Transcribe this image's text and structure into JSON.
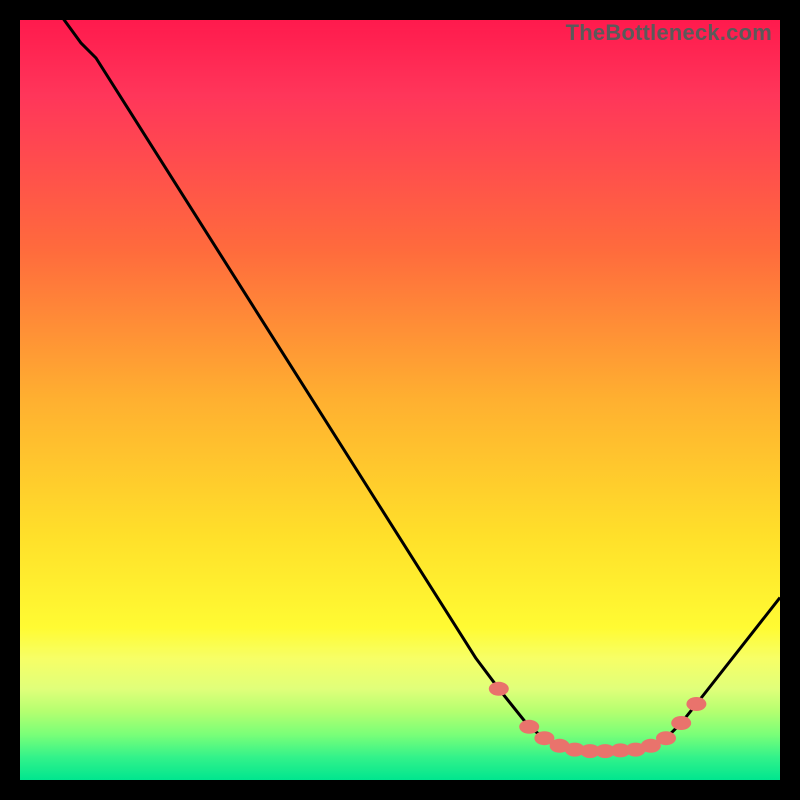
{
  "watermark": "TheBottleneck.com",
  "colors": {
    "marker": "#e9736c",
    "line": "#000000",
    "frame": "#000000"
  },
  "chart_data": {
    "type": "line",
    "title": "",
    "xlabel": "",
    "ylabel": "",
    "xlim": [
      0,
      100
    ],
    "ylim": [
      0,
      100
    ],
    "grid": false,
    "series": [
      {
        "name": "curve",
        "x": [
          0,
          8,
          10,
          60,
          63,
          67,
          69,
          71,
          73,
          75,
          77,
          79,
          81,
          83,
          85,
          87,
          89,
          100
        ],
        "y": [
          108,
          97,
          95,
          16,
          12,
          7,
          5.5,
          4.5,
          4.0,
          3.8,
          3.8,
          3.9,
          4.0,
          4.5,
          5.5,
          7.5,
          10,
          24
        ]
      }
    ],
    "markers": {
      "name": "highlighted-region",
      "x": [
        63,
        67,
        69,
        71,
        73,
        75,
        77,
        79,
        81,
        83,
        85,
        87,
        89
      ],
      "y": [
        12,
        7,
        5.5,
        4.5,
        4.0,
        3.8,
        3.8,
        3.9,
        4.0,
        4.5,
        5.5,
        7.5,
        10
      ]
    }
  }
}
